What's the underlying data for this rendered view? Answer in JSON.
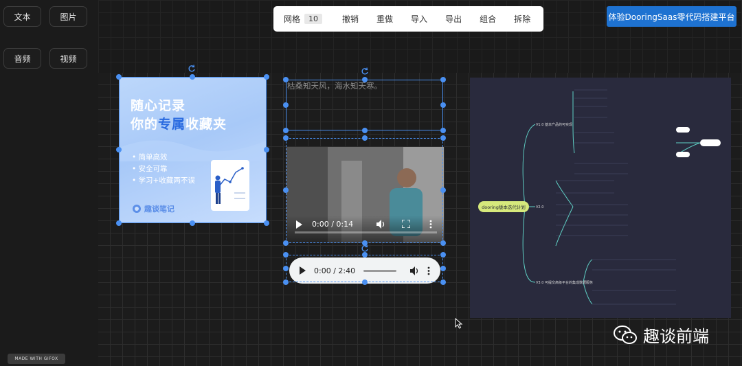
{
  "sidebar": {
    "items": [
      {
        "label": "文本"
      },
      {
        "label": "图片"
      },
      {
        "label": "音频"
      },
      {
        "label": "视频"
      }
    ]
  },
  "toolbar": {
    "grid_label": "网格",
    "grid_value": "10",
    "buttons": [
      "撤销",
      "重做",
      "导入",
      "导出",
      "组合",
      "拆除"
    ]
  },
  "cta": {
    "label": "体验DooringSaas零代码搭建平台"
  },
  "image_card": {
    "title_line1": "随心记录",
    "title_line2_prefix": "你的",
    "title_line2_highlight": "专属",
    "title_line2_suffix": "收藏夹",
    "bullets": [
      "• 简单高效",
      "• 安全可靠",
      "• 学习+收藏两不误"
    ],
    "brand": "趣谈笔记"
  },
  "text_element": {
    "content": "枯桑知天风，海水知天寒。"
  },
  "video": {
    "time": "0:00 / 0:14"
  },
  "audio": {
    "time": "0:00 / 2:40"
  },
  "mindmap": {
    "root": "dooring版本迭代计划",
    "branches": [
      "V1.0 基本产品的可实现",
      "V2.0",
      "V3.0 可提交高级平台的集成数据服务"
    ]
  },
  "watermark": {
    "text": "趣谈前端"
  },
  "gifox": {
    "text": "MADE WITH GIFOX"
  },
  "colors": {
    "accent": "#1e72d1",
    "selection": "#4a90f2",
    "background": "#1b1b1b"
  }
}
